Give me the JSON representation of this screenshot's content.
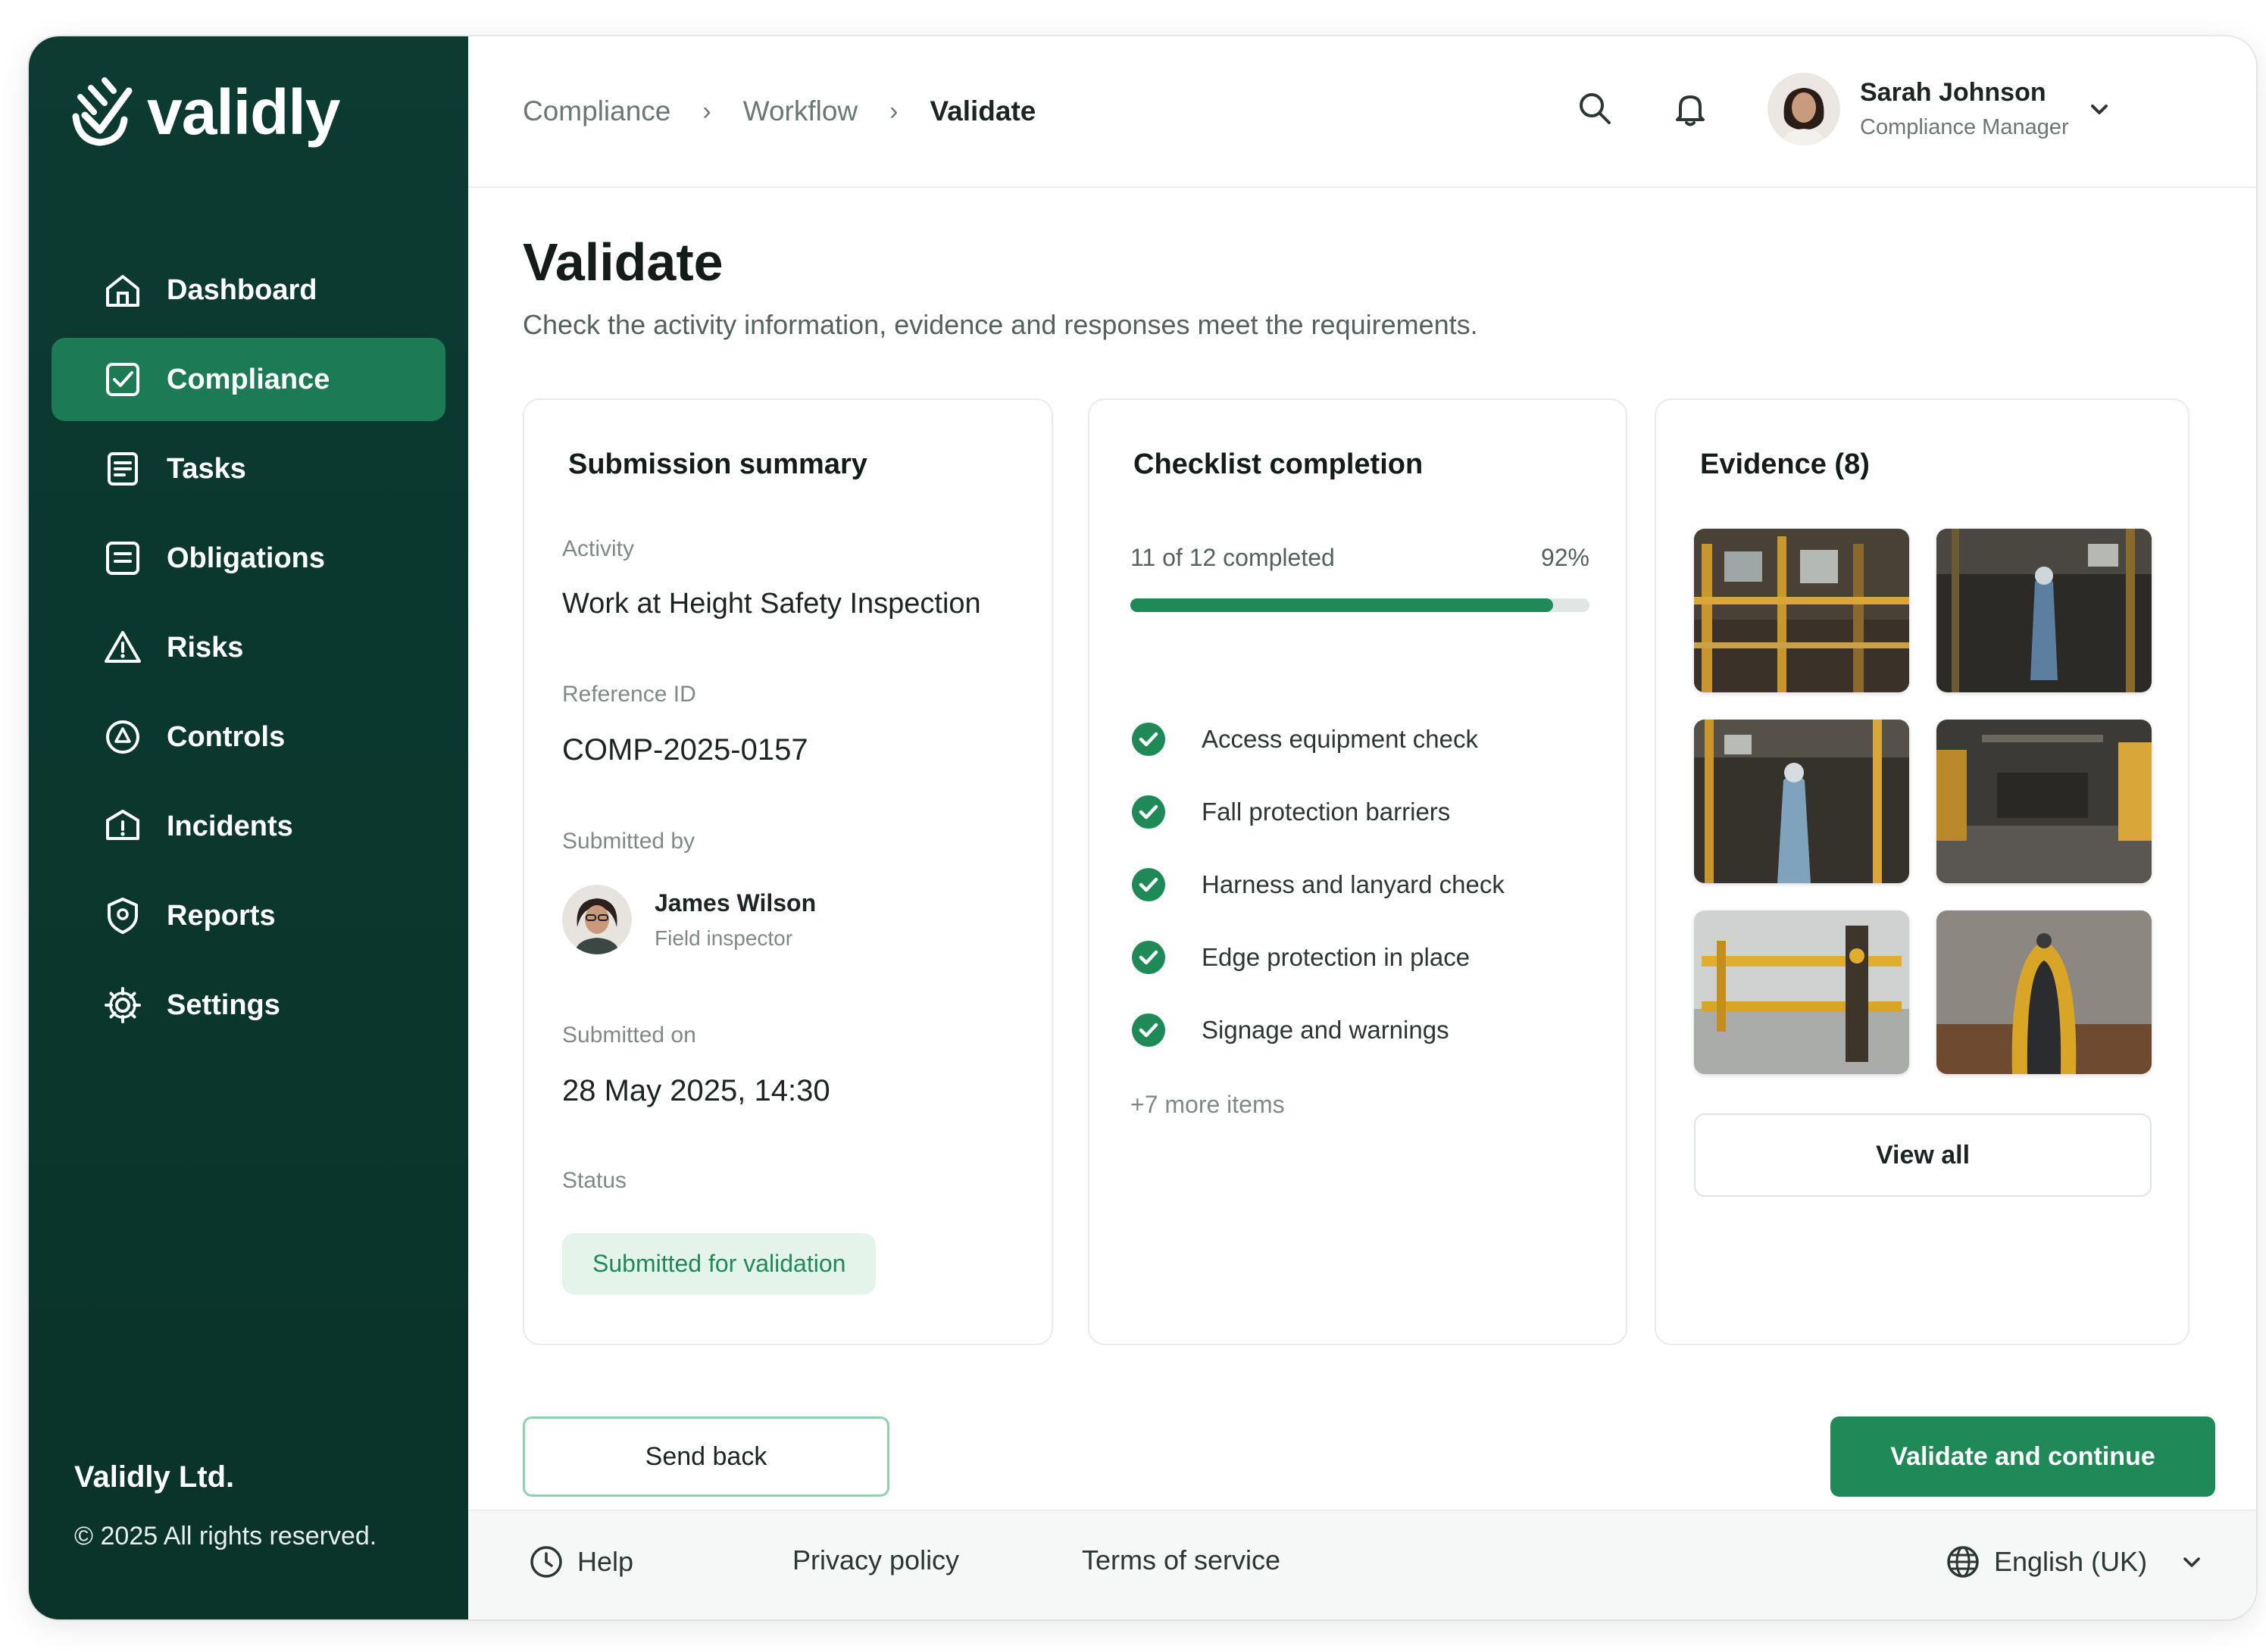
{
  "brand": {
    "name": "validly",
    "company": "Validly Ltd.",
    "copyright": "© 2025 All rights reserved.",
    "accent": "#1f8a57",
    "sidebar_bg": "#0c3b31"
  },
  "sidebar": {
    "items": [
      {
        "label": "Dashboard",
        "icon": "home-icon",
        "active": false
      },
      {
        "label": "Compliance",
        "icon": "compliance-icon",
        "active": true
      },
      {
        "label": "Tasks",
        "icon": "tasks-icon",
        "active": false
      },
      {
        "label": "Obligations",
        "icon": "obligations-icon",
        "active": false
      },
      {
        "label": "Risks",
        "icon": "warning-icon",
        "active": false
      },
      {
        "label": "Controls",
        "icon": "controls-icon",
        "active": false
      },
      {
        "label": "Incidents",
        "icon": "incident-icon",
        "active": false
      },
      {
        "label": "Reports",
        "icon": "reports-icon",
        "active": false
      },
      {
        "label": "Settings",
        "icon": "gear-icon",
        "active": false
      }
    ]
  },
  "header": {
    "breadcrumb": [
      "Compliance",
      "Workflow",
      "Validate"
    ],
    "icons": [
      "search-icon",
      "bell-icon",
      "help-icon"
    ],
    "user": {
      "name": "Sarah Johnson",
      "role": "Compliance Manager"
    }
  },
  "page": {
    "title": "Validate",
    "subtitle": "Check the activity information, evidence and responses meet the requirements."
  },
  "summary": {
    "title": "Submission summary",
    "activity_label": "Activity",
    "activity": "Work at Height Safety Inspection",
    "reference_label": "Reference ID",
    "reference": "COMP-2025-0157",
    "submitted_by_label": "Submitted by",
    "submitter_name": "James Wilson",
    "submitter_role": "Field inspector",
    "submitted_on_label": "Submitted on",
    "submitted_on": "28 May 2025, 14:30",
    "status_label": "Status",
    "status": "Submitted for validation"
  },
  "checklist": {
    "title": "Checklist completion",
    "progress_text": "11 of 12 completed",
    "percent_label": "92%",
    "percent": 92,
    "items": [
      "Access equipment check",
      "Fall protection barriers",
      "Harness and lanyard check",
      "Edge protection in place",
      "Signage and warnings"
    ],
    "more": "+7 more items"
  },
  "evidence": {
    "title": "Evidence (8)",
    "view_all": "View all"
  },
  "actions": {
    "send_back": "Send back",
    "validate": "Validate and continue"
  },
  "footer": {
    "help": "Help",
    "privacy": "Privacy policy",
    "terms": "Terms of service",
    "language": "English (UK)"
  }
}
